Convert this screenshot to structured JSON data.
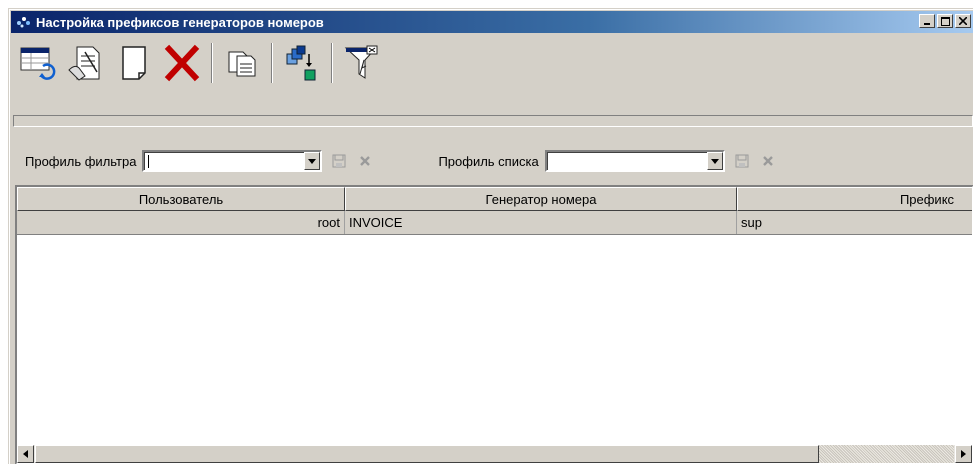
{
  "window": {
    "title": "Настройка префиксов генераторов номеров"
  },
  "title_buttons": {
    "minimize": "_",
    "maximize": "□",
    "close": "×"
  },
  "toolbar": {
    "icons": [
      "refresh-list-icon",
      "edit-document-icon",
      "new-document-icon",
      "delete-icon",
      "copy-icon",
      "hierarchy-icon",
      "filter-icon"
    ]
  },
  "filter": {
    "filter_profile_label": "Профиль фильтра",
    "filter_profile_value": "",
    "list_profile_label": "Профиль списка",
    "list_profile_value": ""
  },
  "table": {
    "columns": [
      "Пользователь",
      "Генератор номера",
      "Префикс"
    ],
    "rows": [
      {
        "user": "root",
        "generator": "INVOICE",
        "prefix": "sup"
      }
    ]
  }
}
